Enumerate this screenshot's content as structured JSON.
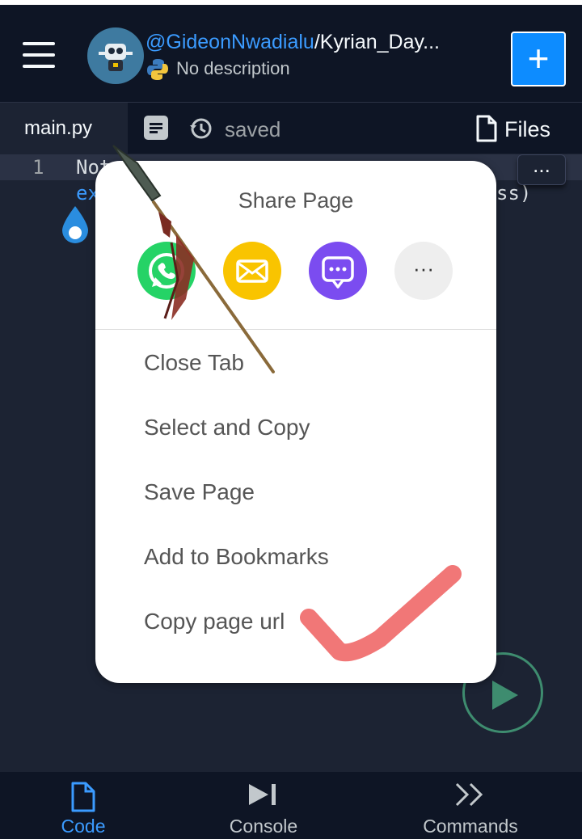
{
  "header": {
    "owner": "@GideonNwadialu",
    "separator": "/",
    "repo": "Kyrian_Day...",
    "description": "No description",
    "add_label": "+"
  },
  "tabs": {
    "active_tab": "main.py",
    "saved_status": "saved",
    "files_label": "Files"
  },
  "editor": {
    "line_number": "1",
    "line1_visible": "Not",
    "line2_visible": "ex",
    "line2_tail": "ss)",
    "overflow_label": "..."
  },
  "share_sheet": {
    "title": "Share Page",
    "targets": [
      "whatsapp-icon",
      "email-icon",
      "message-icon",
      "more-icon"
    ],
    "more_label": "···",
    "items": [
      {
        "label": "Close Tab"
      },
      {
        "label": "Select and Copy"
      },
      {
        "label": "Save Page"
      },
      {
        "label": "Add to Bookmarks"
      },
      {
        "label": "Copy page url"
      }
    ]
  },
  "bottom_nav": [
    {
      "label": "Code",
      "icon": "file-icon",
      "active": true
    },
    {
      "label": "Console",
      "icon": "play-bar-icon",
      "active": false
    },
    {
      "label": "Commands",
      "icon": "chevrons-icon",
      "active": false
    }
  ],
  "colors": {
    "accent": "#0d8cff",
    "background": "#1c2333",
    "bar": "#0e1525",
    "whatsapp": "#25d366",
    "email": "#f9c400",
    "message": "#7b4cf0",
    "checkmark": "#f07070"
  }
}
